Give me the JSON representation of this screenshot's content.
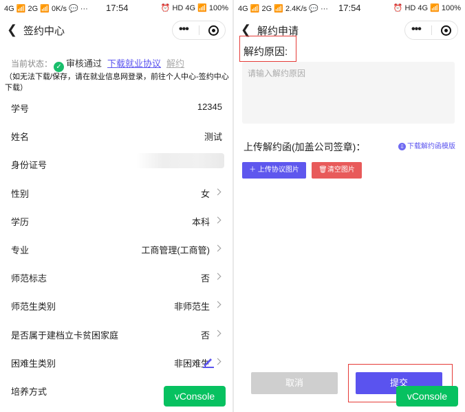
{
  "colors": {
    "accent": "#5a53ef",
    "success": "#19be6b",
    "danger": "#e85a5a",
    "vconsole": "#07c160",
    "highlight_box": "#e53935"
  },
  "left_screen": {
    "statusbar": {
      "left": "4G 📶 2G 📶 0K/s 💬 ···",
      "time": "17:54",
      "right": "⏰ HD 4G 📶 100%"
    },
    "nav": {
      "back_icon": "chevron-left",
      "title": "签约中心",
      "more_icon": "dots",
      "close_icon": "target-circle"
    },
    "status": {
      "label": "当前状态：",
      "icon": "check-circle",
      "value": "审核通过",
      "download_link": "下载就业协议",
      "terminate_link": "解约"
    },
    "note": "（如无法下载/保存，请在就业信息网登录，前往个人中心-签约中心下载）",
    "rows": [
      {
        "key": "学号",
        "value": "12345"
      },
      {
        "key": "姓名",
        "value": "测试"
      },
      {
        "key": "身份证号",
        "value": ""
      },
      {
        "key": "性别",
        "value": "女"
      },
      {
        "key": "学历",
        "value": "本科"
      },
      {
        "key": "专业",
        "value": "工商管理(工商管)"
      },
      {
        "key": "师范标志",
        "value": "否"
      },
      {
        "key": "师范生类别",
        "value": "非师范生"
      },
      {
        "key": "是否属于建档立卡贫困家庭",
        "value": "否"
      },
      {
        "key": "困难生类别",
        "value": "非困难生"
      },
      {
        "key": "培养方式",
        "value": ""
      }
    ],
    "vconsole": "vConsole"
  },
  "right_screen": {
    "statusbar": {
      "left": "4G 📶 2G 📶 2.4K/s 💬 ···",
      "time": "17:54",
      "right": "⏰ HD 4G 📶 100%"
    },
    "nav": {
      "back_icon": "chevron-left",
      "title": "解约申请",
      "more_icon": "dots",
      "close_icon": "target-circle"
    },
    "reason_title": "解约原因:",
    "reason_placeholder": "请输入解约原因",
    "upload_title": "上传解约函(加盖公司签章)：",
    "template_link": "下载解约函模版",
    "upload_button": "上传协议图片",
    "clear_button": "清空图片",
    "cancel_button": "取消",
    "submit_button": "提交",
    "vconsole": "vConsole"
  }
}
